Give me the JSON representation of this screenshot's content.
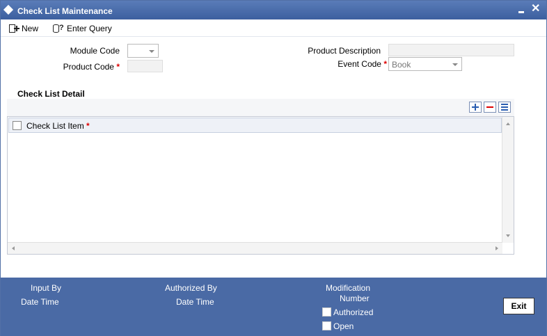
{
  "window": {
    "title": "Check List Maintenance"
  },
  "toolbar": {
    "new_label": "New",
    "enter_query_label": "Enter Query"
  },
  "form": {
    "module_code_label": "Module Code",
    "module_code_value": "",
    "product_code_label": "Product Code",
    "product_code_value": "",
    "product_description_label": "Product Description",
    "product_description_value": "",
    "event_code_label": "Event Code",
    "event_code_value": "Book",
    "required_marker": "*"
  },
  "checklist": {
    "section_title": "Check List Detail",
    "columns": [
      "Check List Item"
    ],
    "rows": []
  },
  "footer": {
    "input_by_label": "Input By",
    "date_time_label_1": "Date Time",
    "authorized_by_label": "Authorized By",
    "date_time_label_2": "Date Time",
    "modification_label": "Modification",
    "number_label": "Number",
    "authorized_checkbox_label": "Authorized",
    "open_checkbox_label": "Open",
    "exit_label": "Exit"
  },
  "colors": {
    "titlebar": "#3c5f9f",
    "footer": "#4a6aa5",
    "required": "#dd0000"
  }
}
